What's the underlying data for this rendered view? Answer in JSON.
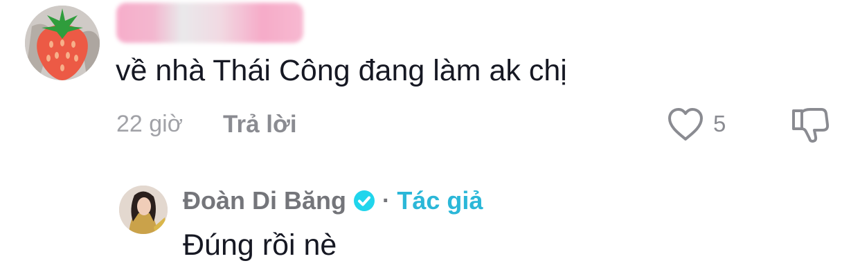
{
  "comment": {
    "text": "về nhà Thái Công đang làm ak chị",
    "time": "22 giờ",
    "reply_label": "Trả lời",
    "like_count": "5",
    "icons": {
      "like": "heart-outline-icon",
      "dislike": "thumbs-down-icon"
    }
  },
  "reply": {
    "author_name": "Đoàn Di Băng",
    "separator": "·",
    "author_tag": "Tác giả",
    "text": "Đúng rồi nè",
    "icons": {
      "verified": "verified-badge-icon"
    }
  },
  "colors": {
    "text": "#161823",
    "muted": "#8a8b91",
    "author_accent": "#2bb7d8",
    "verified": "#20d5ec"
  }
}
